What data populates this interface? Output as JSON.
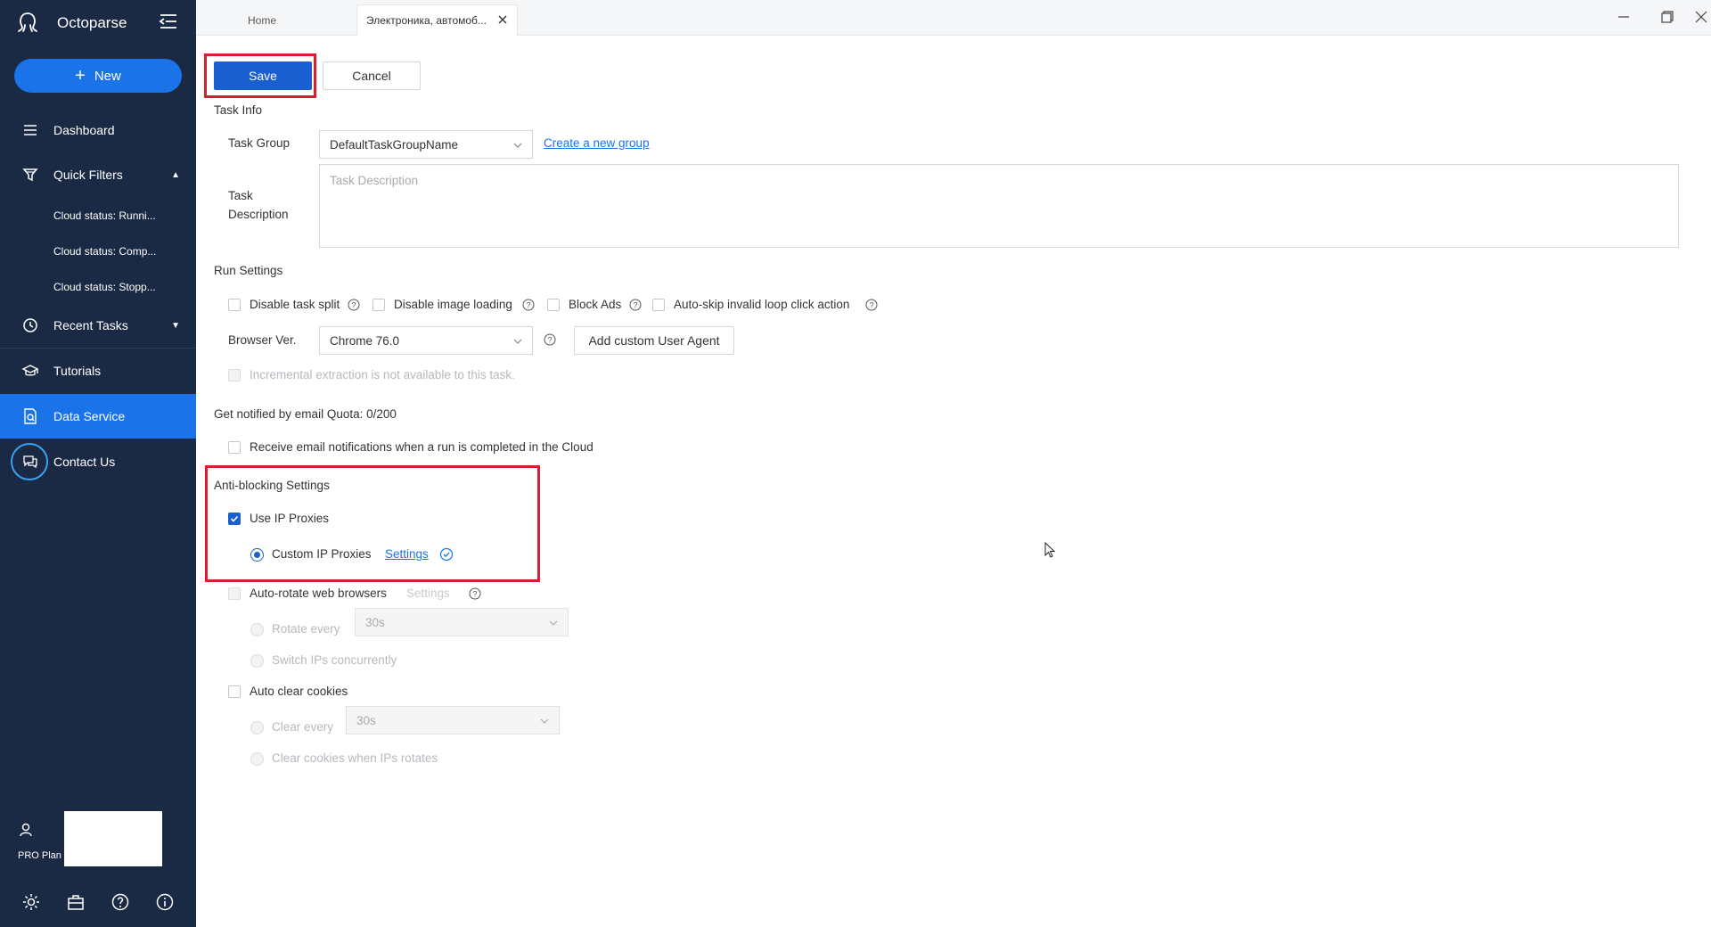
{
  "app": {
    "name": "Octoparse"
  },
  "sidebar": {
    "new_label": "New",
    "items": [
      {
        "label": "Dashboard"
      },
      {
        "label": "Quick Filters"
      },
      {
        "label": "Recent Tasks"
      },
      {
        "label": "Tutorials"
      },
      {
        "label": "Data Service"
      },
      {
        "label": "Contact Us"
      }
    ],
    "filters": [
      "Cloud status: Runni...",
      "Cloud status: Comp...",
      "Cloud status: Stopp..."
    ],
    "plan_label": "PRO Plan"
  },
  "tabs": [
    {
      "label": "Home"
    },
    {
      "label": "Электроника, автомоб..."
    }
  ],
  "toolbar": {
    "save_label": "Save",
    "cancel_label": "Cancel"
  },
  "task_info": {
    "title": "Task Info",
    "group_label": "Task Group",
    "group_value": "DefaultTaskGroupName",
    "create_group_link": "Create a new group",
    "description_label_1": "Task",
    "description_label_2": "Description",
    "description_placeholder": "Task Description"
  },
  "run_settings": {
    "title": "Run Settings",
    "options": [
      {
        "label": "Disable task split",
        "checked": false
      },
      {
        "label": "Disable image loading",
        "checked": false
      },
      {
        "label": "Block Ads",
        "checked": false
      },
      {
        "label": "Auto-skip invalid loop click action",
        "checked": false
      }
    ],
    "browser_label": "Browser Ver.",
    "browser_value": "Chrome 76.0",
    "user_agent_button": "Add custom User Agent",
    "incremental_label": "Incremental extraction is not available to this task."
  },
  "notify": {
    "title": "Get notified by email Quota: 0/200",
    "option_label": "Receive email notifications when a run is completed in the Cloud"
  },
  "anti_blocking": {
    "title": "Anti-blocking Settings",
    "use_proxies_label": "Use IP Proxies",
    "custom_proxies_label": "Custom IP Proxies",
    "settings_link": "Settings",
    "auto_rotate_label": "Auto-rotate web browsers",
    "auto_rotate_settings": "Settings",
    "rotate_every_label": "Rotate every",
    "rotate_every_value": "30s",
    "switch_ips_label": "Switch IPs concurrently",
    "auto_clear_label": "Auto clear cookies",
    "clear_every_label": "Clear every",
    "clear_every_value": "30s",
    "clear_on_rotate_label": "Clear cookies when IPs rotates"
  },
  "colors": {
    "sidebar_bg": "#1b2a44",
    "accent": "#1a73e8",
    "primary_button": "#1a5fcf",
    "highlight_box": "#d6202f"
  }
}
